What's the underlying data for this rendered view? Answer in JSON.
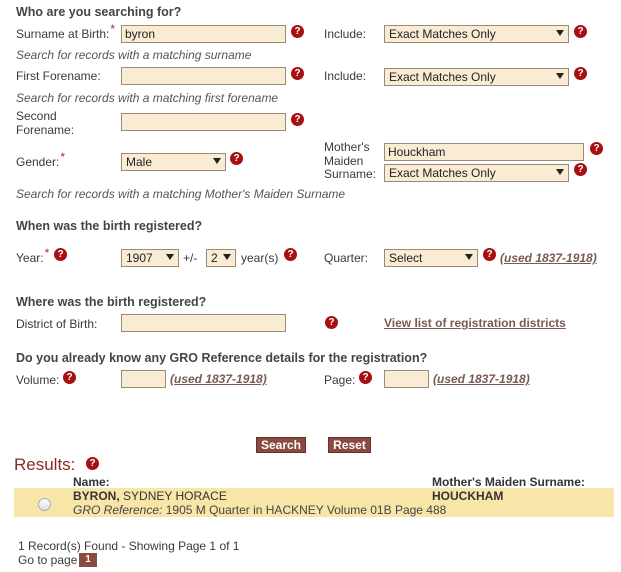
{
  "section1": {
    "heading": "Who are you searching for?",
    "surname_label": "Surname at Birth:",
    "surname_value": "byron",
    "surname_hint": "Search for records with a matching surname",
    "include1_label": "Include:",
    "include1_value": "Exact Matches Only",
    "forename_label": "First Forename:",
    "forename_value": "",
    "forename_hint": "Search for records with a matching first forename",
    "include2_label": "Include:",
    "include2_value": "Exact Matches Only",
    "second_forename_label_1": "Second",
    "second_forename_label_2": "Forename:",
    "second_forename_value": "",
    "gender_label": "Gender:",
    "gender_value": "Male",
    "mmn_label_1": "Mother's",
    "mmn_label_2": "Maiden",
    "mmn_label_3": "Surname:",
    "mmn_value": "Houckham",
    "include3_value": "Exact Matches Only",
    "mmn_hint": "Search for records with a matching Mother's Maiden Surname"
  },
  "section2": {
    "heading": "When was the birth registered?",
    "year_label": "Year:",
    "year_value": "1907",
    "plusminus": "+/-",
    "range_value": "2",
    "years_label": "year(s)",
    "quarter_label": "Quarter:",
    "quarter_value": "Select",
    "quarter_note": "(used 1837-1918)"
  },
  "section3": {
    "heading": "Where was the birth registered?",
    "district_label": "District of Birth:",
    "district_value": "",
    "district_link": "View list of registration districts"
  },
  "section4": {
    "heading": "Do you already know any GRO Reference details for the registration?",
    "volume_label": "Volume:",
    "volume_value": "",
    "volume_note": "(used 1837-1918)",
    "page_label": "Page:",
    "page_value": "",
    "page_note": "(used 1837-1918)"
  },
  "buttons": {
    "search": "Search",
    "reset": "Reset"
  },
  "results": {
    "title": "Results:",
    "col_name": "Name:",
    "col_mmn": "Mother's Maiden Surname:",
    "rows": [
      {
        "surname": "BYRON,",
        "forenames": "SYDNEY  HORACE",
        "mmn": "HOUCKHAM",
        "ref_label": "GRO Reference:",
        "ref_value": "1905  M Quarter in HACKNEY  Volume 01B  Page 488"
      }
    ],
    "found_text": "1 Record(s) Found - Showing Page 1 of 1",
    "goto_label": "Go to page",
    "page_number": "1"
  },
  "colors": {
    "input_bg": "#f9ecd3",
    "button_bg": "#8b4a40",
    "help_icon": "#a80f12",
    "result_bg": "#f8e6a9",
    "required": "#d31a1a"
  }
}
